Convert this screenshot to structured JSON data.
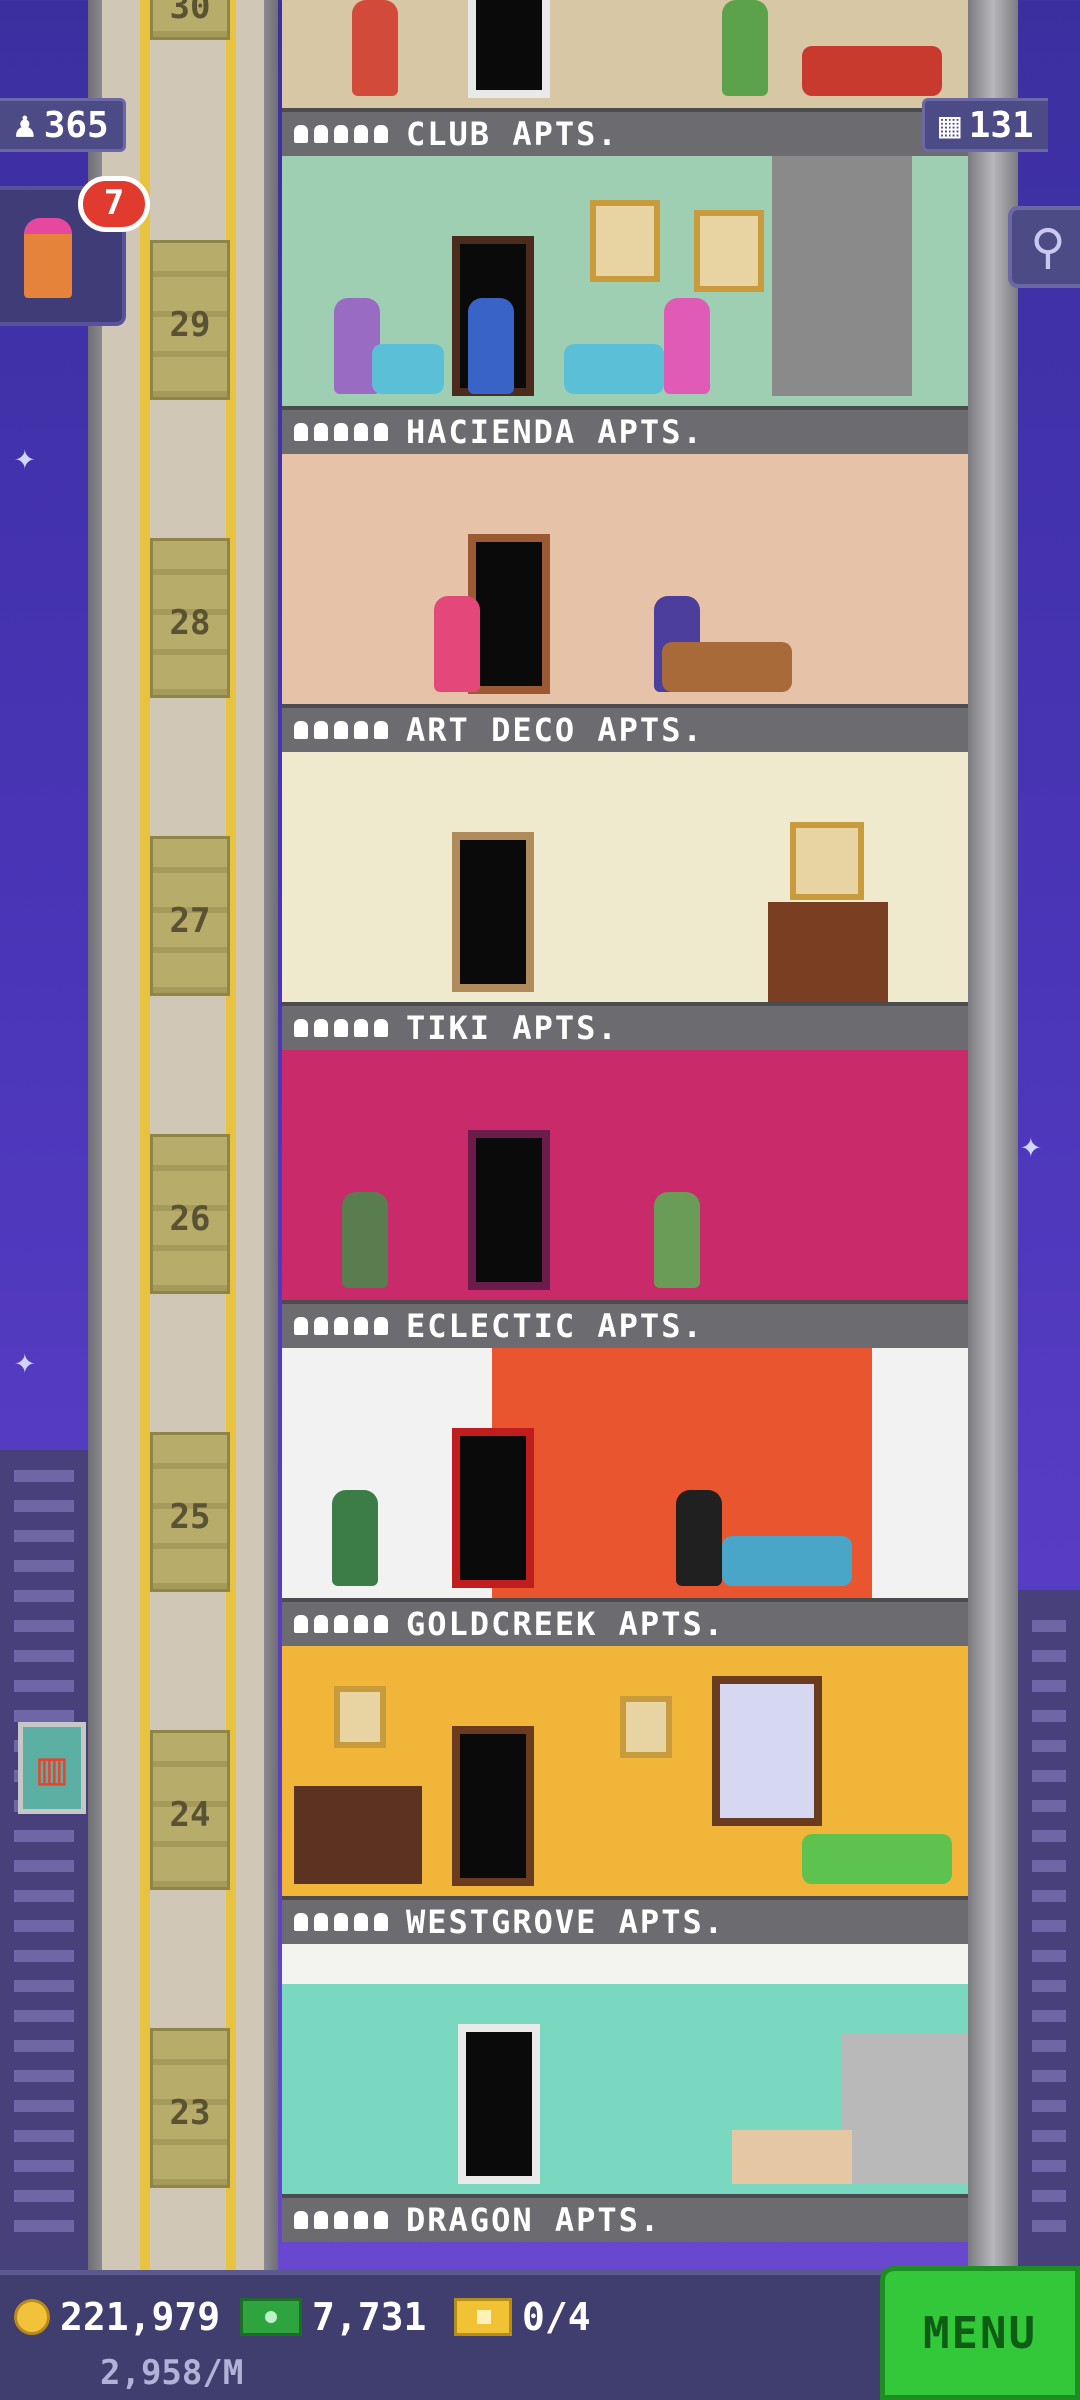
{
  "hud": {
    "population": "365",
    "floors_count": "131",
    "visitor_count": "7"
  },
  "icons": {
    "population": "person-icon",
    "floors": "building-icon",
    "search": "magnifier-icon",
    "promo": "fries-icon",
    "coins": "coin-icon",
    "bux": "tower-bux-icon",
    "tickets": "ticket-icon"
  },
  "shaft": {
    "top_floor_number": "30"
  },
  "floors": [
    {
      "number": "29",
      "name": "HACIENDA APTS.",
      "occupancy_label": "CLUB APTS."
    },
    {
      "number": "28",
      "name": "ART DECO APTS.",
      "occupancy_label": "HACIENDA APTS."
    },
    {
      "number": "27",
      "name": "TIKI APTS.",
      "occupancy_label": "ART DECO APTS."
    },
    {
      "number": "26",
      "name": "ECLECTIC APTS.",
      "occupancy_label": "TIKI APTS."
    },
    {
      "number": "25",
      "name": "GOLDCREEK APTS.",
      "occupancy_label": "ECLECTIC APTS."
    },
    {
      "number": "24",
      "name": "WESTGROVE APTS.",
      "occupancy_label": "GOLDCREEK APTS."
    },
    {
      "number": "23",
      "name": "DRAGON APTS.",
      "occupancy_label": "WESTGROVE APTS."
    }
  ],
  "floor_labels": [
    "CLUB APTS.",
    "HACIENDA APTS.",
    "ART DECO APTS.",
    "TIKI APTS.",
    "ECLECTIC APTS.",
    "GOLDCREEK APTS.",
    "WESTGROVE APTS.",
    "DRAGON APTS."
  ],
  "floor_numbers": [
    "29",
    "28",
    "27",
    "26",
    "25",
    "24",
    "23"
  ],
  "bottom_bar": {
    "coins": "221,979",
    "bux": "7,731",
    "tickets": "0/4",
    "rate": "2,958/M",
    "menu_label": "MENU"
  },
  "colors": {
    "sky": "#4a35b8",
    "menu_green": "#33c73a",
    "badge_red": "#e13a2f"
  }
}
